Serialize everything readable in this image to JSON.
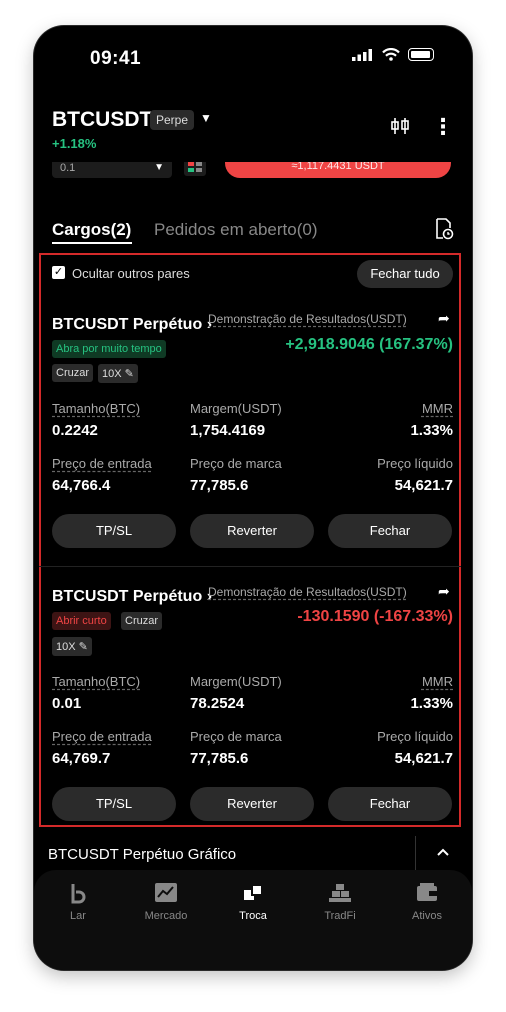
{
  "status_bar": {
    "time": "09:41"
  },
  "header": {
    "symbol": "BTCUSDT",
    "contract_type": "Perpe",
    "change": "+1.18%",
    "partial": {
      "select_value": "0.1",
      "order_amount": "≈1,117.4431 USDT"
    }
  },
  "tabs": {
    "positions": "Cargos(2)",
    "open_orders": "Pedidos em aberto(0)"
  },
  "filter": {
    "hide_other_pairs": "Ocultar outros pares",
    "close_all": "Fechar tudo"
  },
  "positions": [
    {
      "title": "BTCUSDT Perpétuo",
      "pnl_label": "Demonstração de Resultados(USDT)",
      "pnl": "+2,918.9046 (167.37%)",
      "side_tag": "Abra por muito tempo",
      "margin_mode": "Cruzar",
      "leverage": "10X",
      "size_label": "Tamanho(BTC)",
      "size": "0.2242",
      "margin_label": "Margem(USDT)",
      "margin": "1,754.4169",
      "mmr_label": "MMR",
      "mmr": "1.33%",
      "entry_label": "Preço de entrada",
      "entry": "64,766.4",
      "mark_label": "Preço de marca",
      "mark": "77,785.6",
      "liq_label": "Preço líquido",
      "liq": "54,621.7",
      "btn_tpsl": "TP/SL",
      "btn_reverse": "Reverter",
      "btn_close": "Fechar"
    },
    {
      "title": "BTCUSDT Perpétuo",
      "pnl_label": "Demonstração de Resultados(USDT)",
      "pnl": "-130.1590 (-167.33%)",
      "side_tag": "Abrir curto",
      "margin_mode": "Cruzar",
      "leverage": "10X",
      "size_label": "Tamanho(BTC)",
      "size": "0.01",
      "margin_label": "Margem(USDT)",
      "margin": "78.2524",
      "mmr_label": "MMR",
      "mmr": "1.33%",
      "entry_label": "Preço de entrada",
      "entry": "64,769.7",
      "mark_label": "Preço de marca",
      "mark": "77,785.6",
      "liq_label": "Preço líquido",
      "liq": "54,621.7",
      "btn_tpsl": "TP/SL",
      "btn_reverse": "Reverter",
      "btn_close": "Fechar"
    }
  ],
  "chart_bar": {
    "label": "BTCUSDT Perpétuo Gráfico"
  },
  "bottom_nav": [
    {
      "label": "Lar",
      "icon": "home-icon"
    },
    {
      "label": "Mercado",
      "icon": "market-icon"
    },
    {
      "label": "Troca",
      "icon": "trade-icon"
    },
    {
      "label": "TradFi",
      "icon": "tradfi-icon"
    },
    {
      "label": "Ativos",
      "icon": "wallet-icon"
    }
  ],
  "colors": {
    "positive": "#26c281",
    "negative": "#ef4444",
    "highlight_border": "#d42a2a"
  }
}
